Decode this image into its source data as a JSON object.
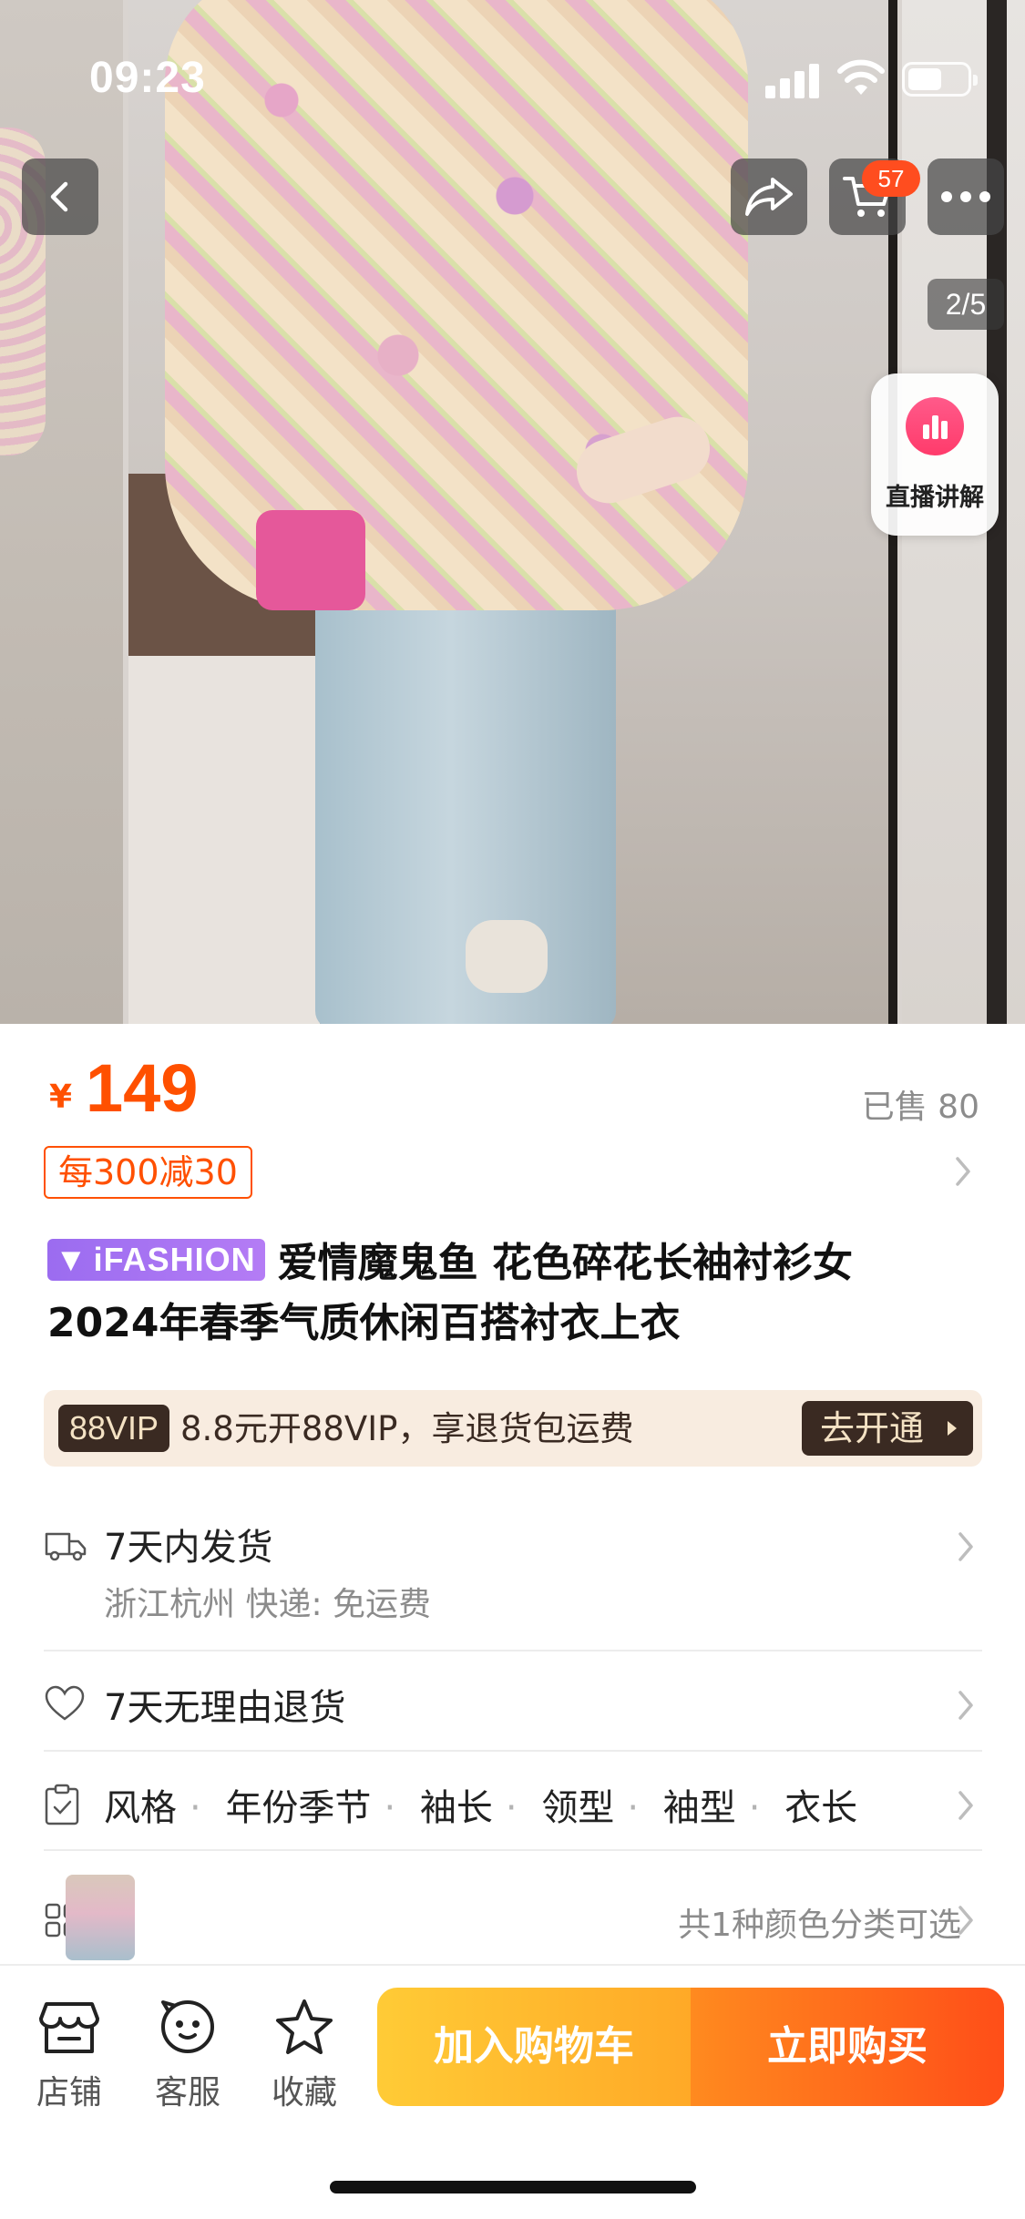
{
  "status_bar": {
    "time": "09:23"
  },
  "gallery": {
    "page_indicator": "2/5",
    "cart_count": "57",
    "live_label": "直播讲解"
  },
  "product": {
    "currency": "¥",
    "price": "149",
    "sold": "已售 80",
    "promo": "每300减30",
    "brand_tag": "iFASHION",
    "title_line1": "爱情魔鬼鱼 花色碎花长袖衬衫女",
    "title_line2": "2024年春季气质休闲百搭衬衣上衣"
  },
  "vip": {
    "badge": "88VIP",
    "text": "8.8元开88VIP，享退货包运费",
    "button": "去开通"
  },
  "shipping": {
    "title": "7天内发货",
    "detail": "浙江杭州  快递: 免运费"
  },
  "returns": {
    "title": "7天无理由退货"
  },
  "attributes": {
    "items": [
      "风格",
      "年份季节",
      "袖长",
      "领型",
      "袖型",
      "衣长"
    ]
  },
  "sku": {
    "text": "共1种颜色分类可选"
  },
  "bottom_bar": {
    "shop": "店铺",
    "service": "客服",
    "favorite": "收藏",
    "add_to_cart": "加入购物车",
    "buy_now": "立即购买"
  },
  "colors": {
    "accent": "#ff5000",
    "vip_dark": "#3a2a22",
    "cart_btn": "#ffb32d",
    "buy_btn": "#ff5a1a"
  }
}
